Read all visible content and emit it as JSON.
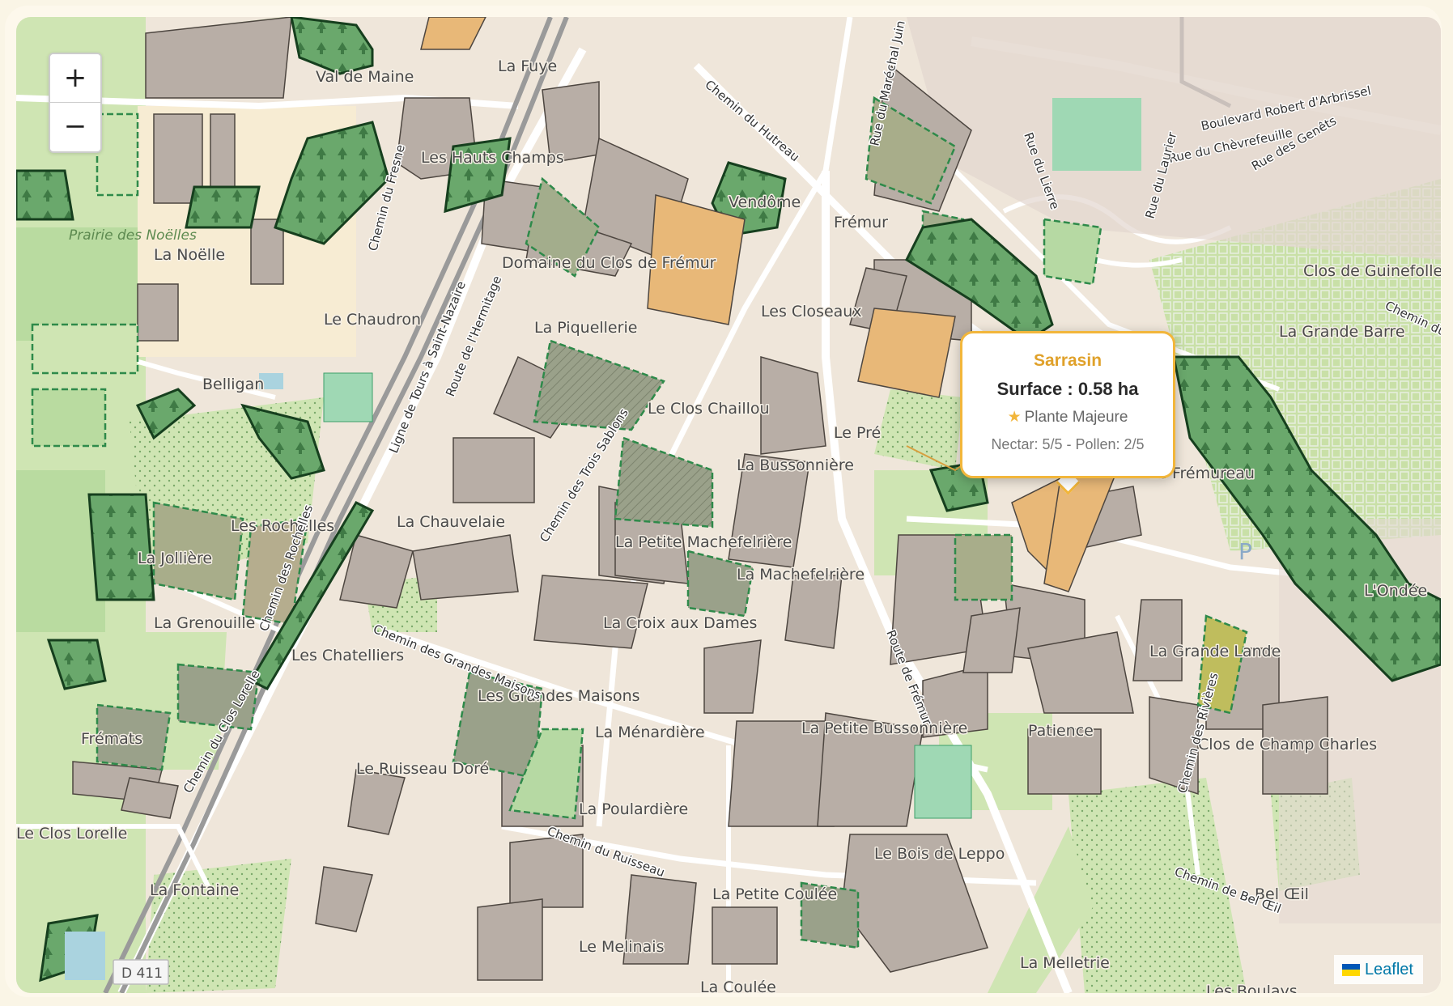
{
  "map": {
    "zoom_in_label": "+",
    "zoom_out_label": "−",
    "places": [
      "Val de Maine",
      "La Fuye",
      "Les Hauts Champs",
      "Prairie des Noëlles",
      "La Noëlle",
      "Le Chaudron",
      "Belligan",
      "Domaine du Clos de Frémur",
      "La Piquellerie",
      "Vendôme",
      "Frémur",
      "Les Closeaux",
      "Clos de Guinefolle",
      "La Grande Barre",
      "Le Clos Chaillou",
      "Le Pré",
      "La Bussonnière",
      "Le Frémureau",
      "La Chauvelaie",
      "Les Rochelles",
      "La Jollière",
      "La Petite Machefelrière",
      "La Machefelrière",
      "La Grenouille",
      "Les Chatelliers",
      "La Croix aux Dames",
      "L'Ondée",
      "La Grande Lande",
      "Les Grandes Maisons",
      "La Ménardière",
      "La Petite Bussonnière",
      "Patience",
      "Frémats",
      "Clos de Champ Charles",
      "Le Ruisseau Doré",
      "La Poulardière",
      "Le Clos Lorelle",
      "Le Bois de Leppo",
      "La Fontaine",
      "La Petite Coulée",
      "Bel Œil",
      "Le Melinais",
      "La Melletrie",
      "La Coulée",
      "Les Boulays"
    ],
    "roads": [
      "Boulevard Robert d'Arbrissel",
      "Rue du Chèvrefeuille",
      "Rue des Genêts",
      "Rue du Lierre",
      "Rue du Laurier",
      "Chemin du Hutreau",
      "Rue du Maréchal Juin",
      "Ligne de Tours à Saint-Nazaire",
      "Route de l'Hermitage",
      "Chemin du Fresne",
      "Chemin des Trois Sablons",
      "Chemin des Rochelles",
      "Chemin des Grandes Maisons",
      "Chemin du Clos Lorelle",
      "Route de Frémur",
      "Chemin du Ruisseau",
      "Chemin des Rivières",
      "Chemin de Bel Œil",
      "Chemin du Lie"
    ],
    "road_ref": "D 411",
    "parking_symbol": "P",
    "attribution": "Leaflet"
  },
  "popup": {
    "title": "Sarrasin",
    "surface": "Surface : 0.58 ha",
    "category": "Plante Majeure",
    "nectar_pollen": "Nectar: 5/5 - Pollen: 2/5"
  },
  "colors": {
    "popup_border": "#f2b63b",
    "highlight_parcel": "#e8b878",
    "forest": "#5a9b62",
    "meadow": "#cde4a8",
    "building": "#b8aea6"
  }
}
